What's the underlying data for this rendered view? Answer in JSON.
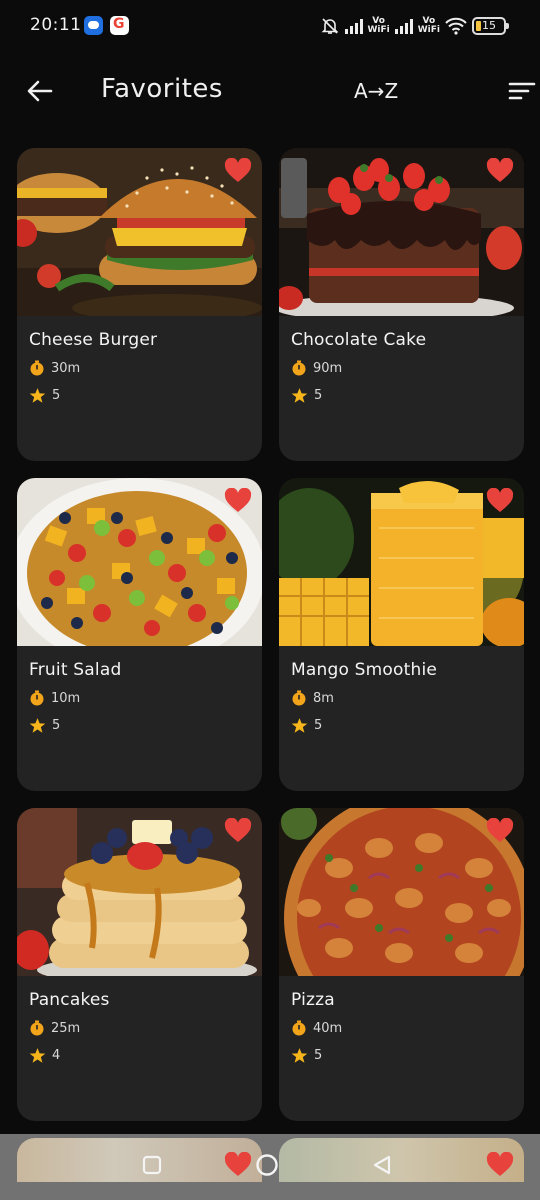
{
  "status_bar": {
    "time": "20:11",
    "network_label_1": "Vo\nWiFi",
    "network_label_2": "Vo\nWiFi",
    "battery_level": "15"
  },
  "header": {
    "title": "Favorites",
    "sort_label": "A→Z"
  },
  "recipes": [
    {
      "name": "Cheese Burger",
      "time": "30m",
      "rating": "5"
    },
    {
      "name": "Chocolate Cake",
      "time": "90m",
      "rating": "5"
    },
    {
      "name": "Fruit Salad",
      "time": "10m",
      "rating": "5"
    },
    {
      "name": "Mango Smoothie",
      "time": "8m",
      "rating": "5"
    },
    {
      "name": "Pancakes",
      "time": "25m",
      "rating": "4"
    },
    {
      "name": "Pizza",
      "time": "40m",
      "rating": "5"
    }
  ],
  "icons": {
    "back": "arrow-left-icon",
    "filter": "sort-lines-icon",
    "favorite": "heart-icon",
    "time": "timer-icon",
    "rating": "star-icon"
  },
  "colors": {
    "background": "#0b0b0b",
    "card": "#232323",
    "heart": "#e8423c",
    "timer": "#f2a51a",
    "star": "#f5b51b"
  }
}
